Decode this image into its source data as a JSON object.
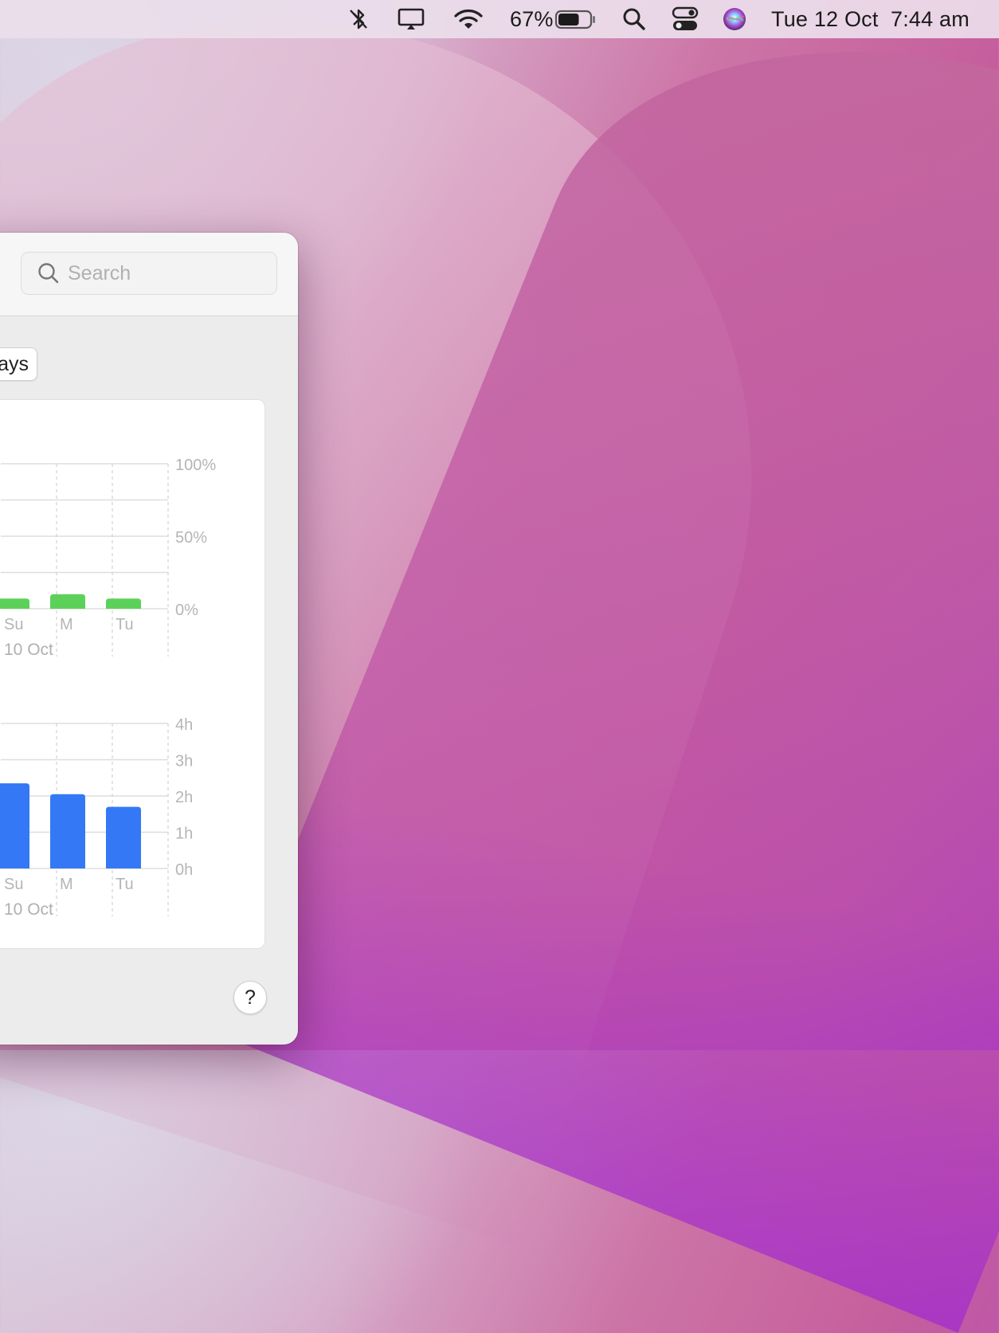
{
  "menubar": {
    "battery_percent": "67%",
    "battery_level": 0.67,
    "date": "Tue 12 Oct",
    "time": "7:44 am",
    "icons": [
      "bluetooth-off-icon",
      "display-icon",
      "wifi-icon",
      "battery-icon",
      "spotlight-search-icon",
      "control-center-icon",
      "siri-icon"
    ]
  },
  "window": {
    "search": {
      "placeholder": "Search"
    },
    "range_button_label": "ays",
    "help_label": "?"
  },
  "colors": {
    "green_bar": "#5cd15a",
    "blue_bar": "#3478f6"
  },
  "chart_data": [
    {
      "type": "bar",
      "categories": [
        "Su",
        "M",
        "Tu"
      ],
      "date_label": "10 Oct",
      "values": [
        7,
        10,
        7
      ],
      "ylim": [
        0,
        100
      ],
      "yticks": [
        "100%",
        "50%",
        "0%"
      ],
      "color": "#5cd15a",
      "grid": true
    },
    {
      "type": "bar",
      "categories": [
        "Su",
        "M",
        "Tu"
      ],
      "date_label": "10 Oct",
      "values": [
        2.35,
        2.05,
        1.7
      ],
      "ylim": [
        0,
        4
      ],
      "yticks": [
        "4h",
        "3h",
        "2h",
        "1h",
        "0h"
      ],
      "color": "#3478f6",
      "grid": true
    }
  ]
}
